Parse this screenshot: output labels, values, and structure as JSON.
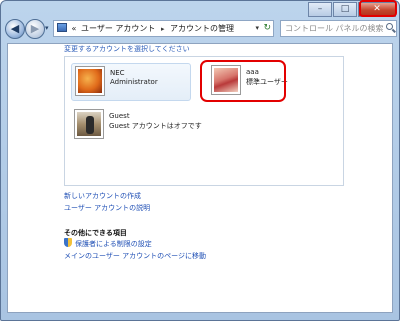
{
  "window": {
    "controls": {
      "minimize": "–",
      "maximize": "□",
      "close": "✕"
    }
  },
  "address": {
    "prefix": "«",
    "crumbs": [
      "ユーザー アカウント",
      "アカウントの管理"
    ],
    "separator": "▸",
    "dropdown": "▾",
    "refresh": "↻"
  },
  "nav": {
    "back": "◀",
    "forward": "▶",
    "history": "▾"
  },
  "search": {
    "placeholder": "コントロール パネルの検索"
  },
  "main": {
    "heading": "変更するアカウントを選択してください",
    "accounts": [
      {
        "name": "NEC",
        "type": "Administrator"
      },
      {
        "name": "aaa",
        "type": "標準ユーザー"
      },
      {
        "name": "Guest",
        "type": "Guest アカウントはオフです"
      }
    ],
    "links": [
      "新しいアカウントの作成",
      "ユーザー アカウントの説明"
    ],
    "section_title": "その他にできる項目",
    "extra_links": [
      "保護者による制限の設定",
      "メインのユーザー アカウントのページに移動"
    ]
  },
  "colors": {
    "highlight": "#e30000",
    "link": "#1f4fb5"
  }
}
